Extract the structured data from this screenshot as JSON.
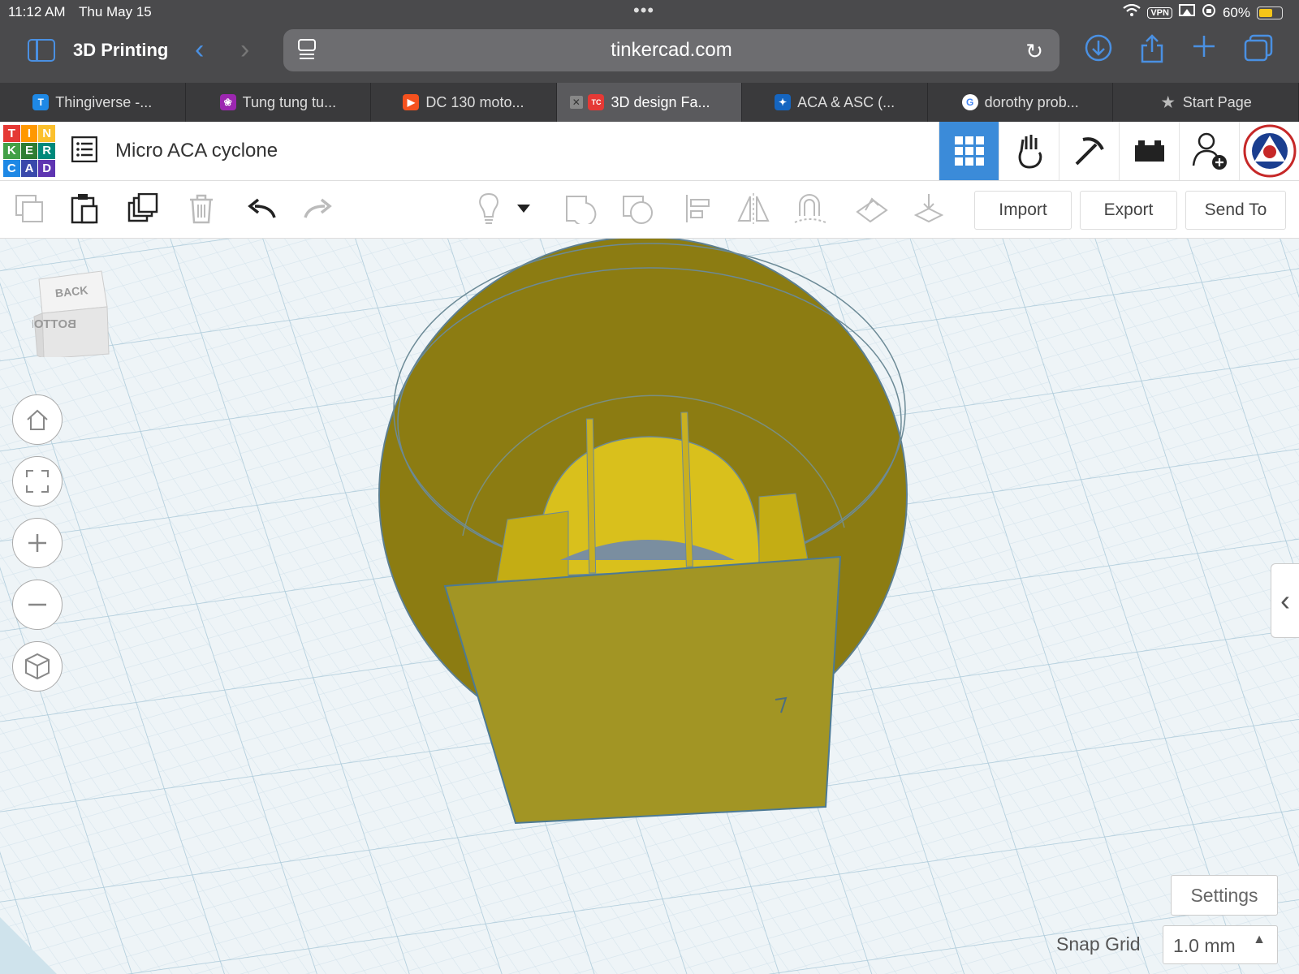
{
  "status_bar": {
    "time": "11:12 AM",
    "date": "Thu May 15",
    "vpn": "VPN",
    "battery": "60%"
  },
  "browser": {
    "tab_group": "3D Printing",
    "url": "tinkercad.com",
    "tabs": [
      {
        "label": "Thingiverse -...",
        "favicon": "T",
        "color": "#1e88e5"
      },
      {
        "label": "Tung tung tu...",
        "favicon": "❀",
        "color": "#9c27b0"
      },
      {
        "label": "DC 130 moto...",
        "favicon": "▶",
        "color": "#f4511e"
      },
      {
        "label": "3D design Fa...",
        "favicon": "TC",
        "color": "#e53935",
        "active": true
      },
      {
        "label": "ACA & ASC (...",
        "favicon": "✦",
        "color": "#1565c0"
      },
      {
        "label": "dorothy prob...",
        "favicon": "G",
        "color": "#ffffff"
      },
      {
        "label": "Start Page",
        "favicon": "★",
        "color": "#bbbbbb"
      }
    ]
  },
  "tinkercad": {
    "logo_letters": [
      "T",
      "I",
      "N",
      "K",
      "E",
      "R",
      "C",
      "A",
      "D"
    ],
    "design_title": "Micro ACA cyclone",
    "toolbar": {
      "import_label": "Import",
      "export_label": "Export",
      "send_to_label": "Send To"
    },
    "viewcube": {
      "top_face": "BACK",
      "front_face": "BOTTOM"
    },
    "settings_label": "Settings",
    "snap_grid_label": "Snap Grid",
    "snap_grid_value": "1.0 mm"
  },
  "colors": {
    "accent": "#3b8bd9",
    "model_dark": "#8c7c12",
    "model_light": "#d9c01c",
    "grid_line": "#b9d3e0"
  }
}
